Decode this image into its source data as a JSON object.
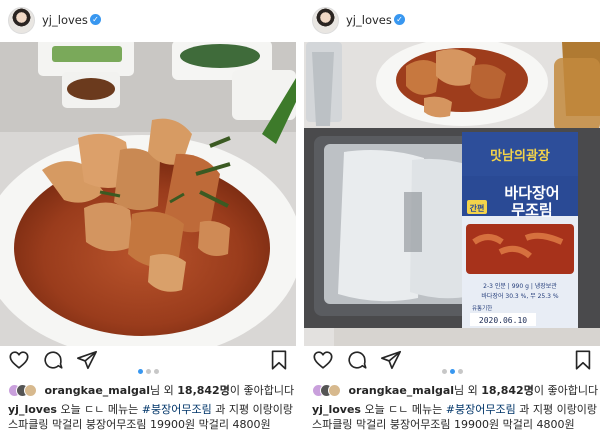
{
  "posts": [
    {
      "username": "yj_loves",
      "verified_icon": "verified-badge-icon",
      "photo_alt": "",
      "likes": {
        "liker": "orangkae_malgal",
        "middle": "님 외 ",
        "count": "18,842명",
        "suffix": "이 좋아합니다"
      },
      "caption": {
        "username": "yj_loves",
        "text_before": " 오늘 ㄷㄴ 메뉴는 ",
        "hashtag": "#붕장어무조림",
        "text_after": " 과 지평 이랑이랑 스파클링 막걸리 붕장어무조림 19900원 막걸리 4800원"
      }
    },
    {
      "username": "yj_loves",
      "verified_icon": "verified-badge-icon",
      "package": {
        "brand": "맛남의광장",
        "product_line1": "바다장어",
        "product_line2": "무조림",
        "tag": "간편",
        "spec": "2-3 인분 | 990 g | 냉장보관",
        "content1": "바다장어 30.3 %, 무 25.3 %",
        "date_label": "유통기한",
        "date": "2020.06.10"
      },
      "likes": {
        "liker": "orangkae_malgal",
        "middle": "님 외 ",
        "count": "18,842명",
        "suffix": "이 좋아합니다"
      },
      "caption": {
        "username": "yj_loves",
        "text_before": " 오늘 ㄷㄴ 메뉴는 ",
        "hashtag": "#붕장어무조림",
        "text_after": " 과 지평 이랑이랑 스파클링 막걸리 붕장어무조림 19900원 막걸리 4800원"
      }
    }
  ],
  "colors": {
    "accent_blue": "#3897f0",
    "hashtag": "#003569",
    "text": "#262626"
  },
  "icons": [
    "heart-icon",
    "comment-icon",
    "share-icon",
    "bookmark-icon",
    "verified-badge-icon"
  ]
}
